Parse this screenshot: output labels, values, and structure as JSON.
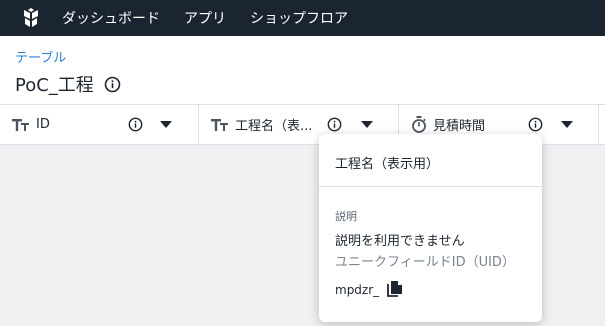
{
  "nav": {
    "items": [
      "ダッシュボード",
      "アプリ",
      "ショップフロア"
    ]
  },
  "header": {
    "breadcrumb": "テーブル",
    "title": "PoC_工程"
  },
  "columns": [
    {
      "label": "ID",
      "icon": "text-type-icon"
    },
    {
      "label": "工程名（表...",
      "icon": "text-type-icon"
    },
    {
      "label": "見積時間",
      "icon": "stopwatch-icon"
    }
  ],
  "popup": {
    "title": "工程名（表示用）",
    "description_label": "説明",
    "description_value": "説明を利用できません",
    "uid_label": "ユニークフィールドID（UID）",
    "uid_value": "mpdzr_"
  },
  "colors": {
    "topbar": "#1b2532",
    "link": "#2d7fd6",
    "background": "#eef0f2"
  }
}
